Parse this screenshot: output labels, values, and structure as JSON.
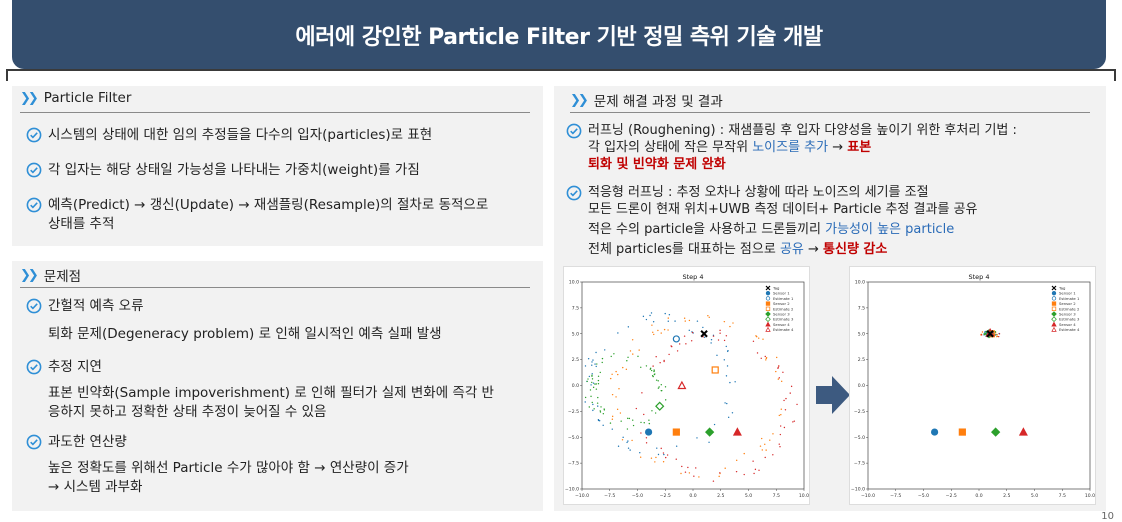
{
  "title": "에러에 강인한 Particle Filter 기반 정밀 측위 기술 개발",
  "left": {
    "pf_header": "Particle Filter",
    "pf_items": [
      "시스템의 상태에 대한 임의 추정들을 다수의 입자(particles)로 표현",
      "각 입자는 해당 상태일 가능성을 나타내는 가중치(weight)를 가짐",
      "예측(Predict) → 갱신(Update) → 재샘플링(Resample)의 절차로 동적으로",
      "상태를 추적"
    ],
    "prob_header": "문제점",
    "problems": [
      {
        "title": "간헐적 예측 오류",
        "body": [
          "퇴화 문제(Degeneracy problem) 로 인해 일시적인 예측 실패 발생"
        ]
      },
      {
        "title": "추정 지연",
        "body": [
          "표본 빈약화(Sample impoverishment) 로 인해 필터가 실제 변화에 즉각 반",
          "응하지 못하고 정확한 상태 추정이 늦어질 수 있음"
        ]
      },
      {
        "title": "과도한 연산량",
        "body": [
          "높은 정확도를 위해선 Particle 수가 많아야 함 → 연산량이 증가",
          "→ 시스템 과부화"
        ]
      }
    ]
  },
  "right": {
    "header": "문제 해결 과정 및 결과",
    "r1_line1": "러프닝 (Roughening) : 재샘플링 후 입자 다양성을  높이기 위한 후처리 기법 :",
    "r1_line2a": "각 입자의 상태에 작은 무작위 ",
    "r1_line2b": "노이즈를 추가",
    "r1_line2c": " → ",
    "r1_line2d": "표본",
    "r1_line3": "퇴화 및 빈약화 문제 완화",
    "r2_line1": "적응형 러프닝 : 추정 오차나 상황에 따라 노이즈의 세기를 조절",
    "r2_line2": "모든 드론이 현재 위치+UWB 측정 데이터+ Particle 추정 결과를 공유",
    "r2_line3a": "적은 수의 particle을 사용하고 드론들끼리 ",
    "r2_line3b": "가능성이 높은 particle",
    "r2_line4a": "전체 particles를 대표하는 점으로 ",
    "r2_line4b": "공유",
    "r2_line4c": " → ",
    "r2_line4d": "통신량 감소"
  },
  "legend_labels": [
    "Tag",
    "Sensor 1",
    "Estimate 1",
    "Sensor 2",
    "Estimate 2",
    "Sensor 3",
    "Estimate 3",
    "Sensor 4",
    "Estimate 4"
  ],
  "chart_data": [
    {
      "type": "scatter",
      "title": "Step 4",
      "xlim": [
        -10,
        10
      ],
      "ylim": [
        -10,
        10
      ],
      "xticks": [
        "−10.0",
        "−7.5",
        "−5.0",
        "−2.5",
        "0.0",
        "2.5",
        "5.0",
        "7.5",
        "10.0"
      ],
      "yticks": [
        "10.0",
        "7.5",
        "5.0",
        "2.5",
        "0.0",
        "−2.5",
        "−5.0",
        "−7.5",
        "−10.0"
      ],
      "tag": [
        1,
        5
      ],
      "sensors": [
        [
          -4,
          -4.5
        ],
        [
          -1.5,
          -4.5
        ],
        [
          1.5,
          -4.5
        ],
        [
          4,
          -4.5
        ]
      ],
      "estimates": [
        [
          -1.5,
          4.5
        ],
        [
          2,
          1.5
        ],
        [
          -3,
          -2
        ],
        [
          -1,
          0
        ]
      ],
      "particles": "spread"
    },
    {
      "type": "scatter",
      "title": "Step 4",
      "xlim": [
        -10,
        10
      ],
      "ylim": [
        -10,
        10
      ],
      "xticks": [
        "−10.0",
        "−7.5",
        "−5.0",
        "−2.5",
        "0.0",
        "2.5",
        "5.0",
        "7.5",
        "10.0"
      ],
      "yticks": [
        "10.0",
        "7.5",
        "5.0",
        "2.5",
        "0.0",
        "−2.5",
        "−5.0",
        "−7.5",
        "−10.0"
      ],
      "tag": [
        1,
        5
      ],
      "sensors": [
        [
          -4,
          -4.5
        ],
        [
          -1.5,
          -4.5
        ],
        [
          1.5,
          -4.5
        ],
        [
          4,
          -4.5
        ]
      ],
      "estimates": [
        [
          1,
          5
        ],
        [
          1.1,
          5
        ],
        [
          0.9,
          5
        ],
        [
          1,
          5.1
        ]
      ],
      "particles": "clustered"
    }
  ],
  "colors": {
    "banner": "#344e6e",
    "accent_blue": "#2a6bb7",
    "accent_red": "#c00000",
    "tag": "#000000",
    "s1": "#1f77b4",
    "s2": "#ff7f0e",
    "s3": "#2ca02c",
    "s4": "#d62728",
    "arrow": "#3d5a80"
  },
  "page_number": "10"
}
